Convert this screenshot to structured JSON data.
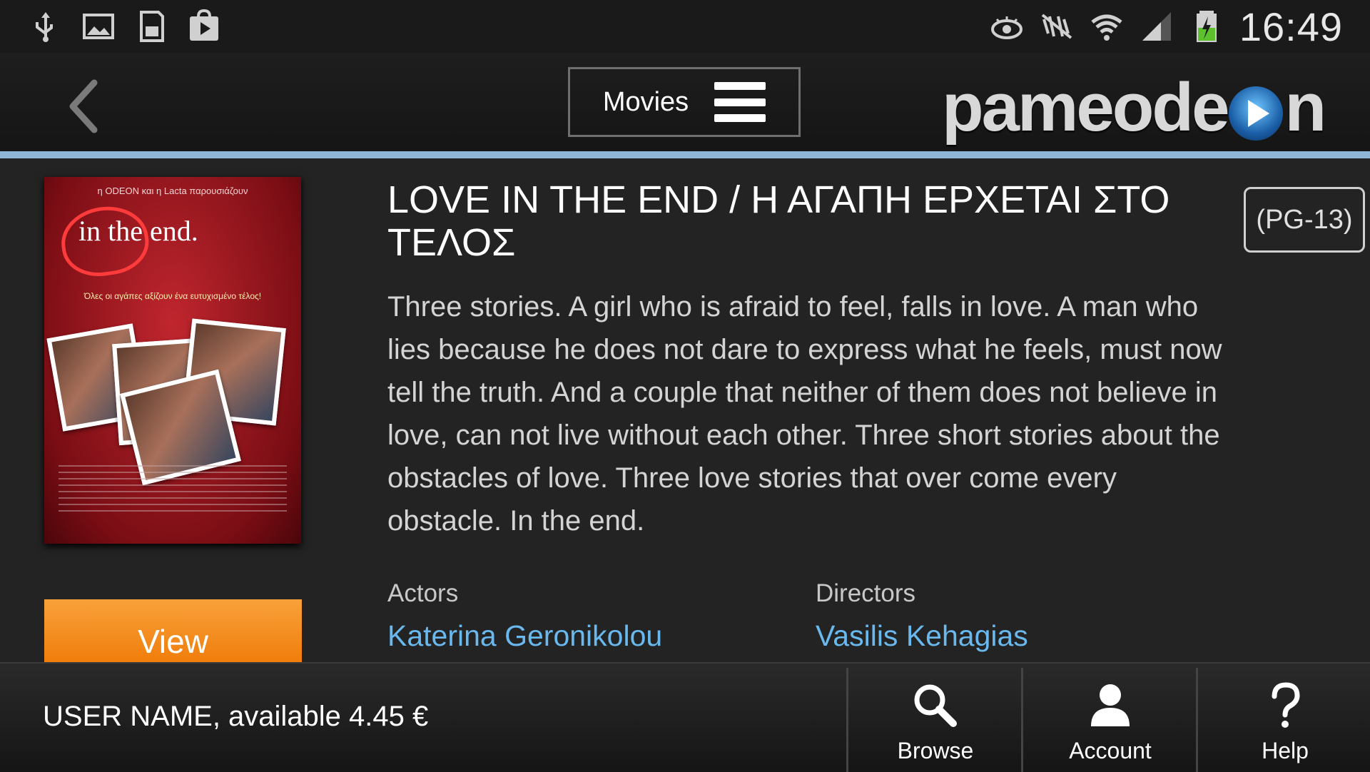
{
  "status_bar": {
    "left_icons": [
      "usb-icon",
      "image-icon",
      "sd-card-icon",
      "play-store-icon"
    ],
    "right_icons": [
      "eye-icon",
      "no-nfc-icon",
      "wifi-icon",
      "signal-icon",
      "battery-charging-icon"
    ],
    "time": "16:49"
  },
  "header": {
    "category_label": "Movies",
    "logo_text_before": "pameode",
    "logo_text_after": "n"
  },
  "movie": {
    "title": "LOVE IN THE END / Η ΑΓΑΠΗ ΕΡΧΕΤΑΙ ΣΤΟ ΤΕΛΟΣ",
    "rating": "(PG-13)",
    "description": "Three stories. A girl who is afraid to feel, falls in love. A man who lies because he does not dare to express what he feels, must now tell the truth. And a couple that neither of them does not believe in love, can not live without each other. Three short stories about the obstacles of love. Three love stories that over come every obstacle. In the end.",
    "actors_label": "Actors",
    "actors_value": "Katerina Geronikolou",
    "directors_label": "Directors",
    "directors_value": "Vasilis Kehagias",
    "view_label": "View",
    "poster": {
      "top_text": "η ODEON και η Lacta παρουσιάζουν",
      "title_text": "in the end.",
      "tagline": "Όλες οι αγάπες αξίζουν ένα ευτυχισμένο τέλος!"
    }
  },
  "bottom_bar": {
    "user_info": "USER NAME, available 4.45 €",
    "nav": [
      {
        "label": "Browse",
        "icon": "search-icon"
      },
      {
        "label": "Account",
        "icon": "user-icon"
      },
      {
        "label": "Help",
        "icon": "help-icon"
      }
    ]
  },
  "colors": {
    "accent_blue": "#8fb4d6",
    "link_blue": "#69b8ee",
    "view_orange": "#f38a1d",
    "background": "#232323"
  }
}
